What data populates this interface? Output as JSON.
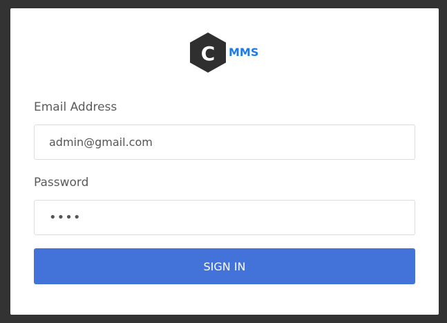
{
  "logo": {
    "letter": "C",
    "text": "MMS",
    "badge_color": "#2f2f2f",
    "text_color": "#1e7be6",
    "icon": "hexagon-logo-icon"
  },
  "form": {
    "email_label": "Email Address",
    "email_value": "admin@gmail.com",
    "password_label": "Password",
    "password_value": "••••",
    "submit_label": "SIGN IN",
    "submit_color": "#4373d8"
  }
}
